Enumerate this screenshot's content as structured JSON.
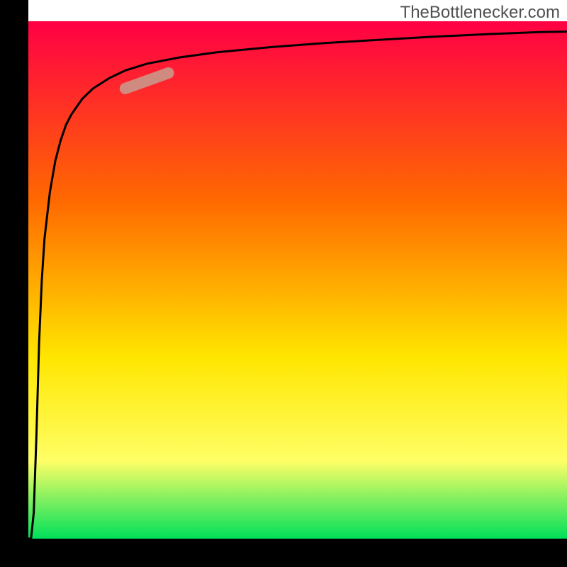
{
  "watermark": "TheBottlenecker.com",
  "chart_data": {
    "type": "line",
    "title": "",
    "xlabel": "",
    "ylabel": "",
    "xlim": [
      0,
      100
    ],
    "ylim": [
      0,
      100
    ],
    "grid": false,
    "legend": false,
    "background_gradient": [
      "#ff0044",
      "#ff6a00",
      "#ffe600",
      "#ffff66",
      "#00e05a"
    ],
    "series": [
      {
        "name": "curve",
        "x": [
          0,
          0.5,
          1,
          1.5,
          2,
          2.5,
          3,
          4,
          5,
          6,
          7,
          8,
          10,
          12,
          15,
          18,
          22,
          28,
          35,
          45,
          55,
          65,
          75,
          85,
          95,
          100
        ],
        "y": [
          0,
          0,
          5,
          20,
          38,
          50,
          58,
          67,
          73,
          77,
          80,
          82,
          85,
          87,
          89,
          90.5,
          91.8,
          93,
          94,
          95,
          95.8,
          96.4,
          97,
          97.5,
          97.9,
          98
        ]
      }
    ],
    "highlight_segment": {
      "x_start": 18,
      "y_start": 87,
      "x_end": 26,
      "y_end": 90
    },
    "axes": {
      "left_border": true,
      "bottom_border": true,
      "border_width_px": 40
    }
  }
}
